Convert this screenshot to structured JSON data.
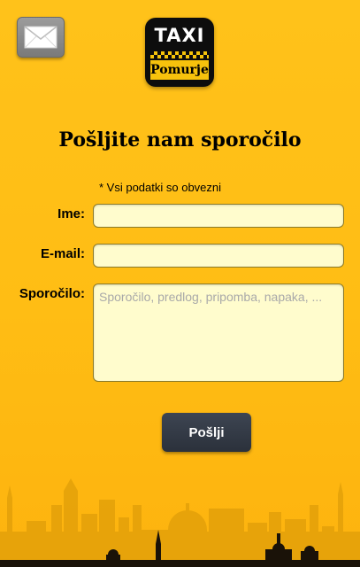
{
  "header": {
    "mail_icon": "envelope-icon",
    "logo": {
      "line1": "TAXI",
      "line2": "Pomurje"
    }
  },
  "form": {
    "title": "Pošljite nam sporočilo",
    "required_note": "*  Vsi podatki so obvezni",
    "fields": {
      "name": {
        "label": "Ime:",
        "value": "",
        "placeholder": ""
      },
      "email": {
        "label": "E-mail:",
        "value": "",
        "placeholder": ""
      },
      "message": {
        "label": "Sporočilo:",
        "value": "",
        "placeholder": "Sporočilo, predlog, pripomba, napaka, ..."
      }
    },
    "submit_label": "Pošlji"
  },
  "colors": {
    "background": "#ffc21a",
    "field_bg": "#fffccd",
    "button_bg": "#2f3640",
    "skyline": "#e4a10a"
  }
}
